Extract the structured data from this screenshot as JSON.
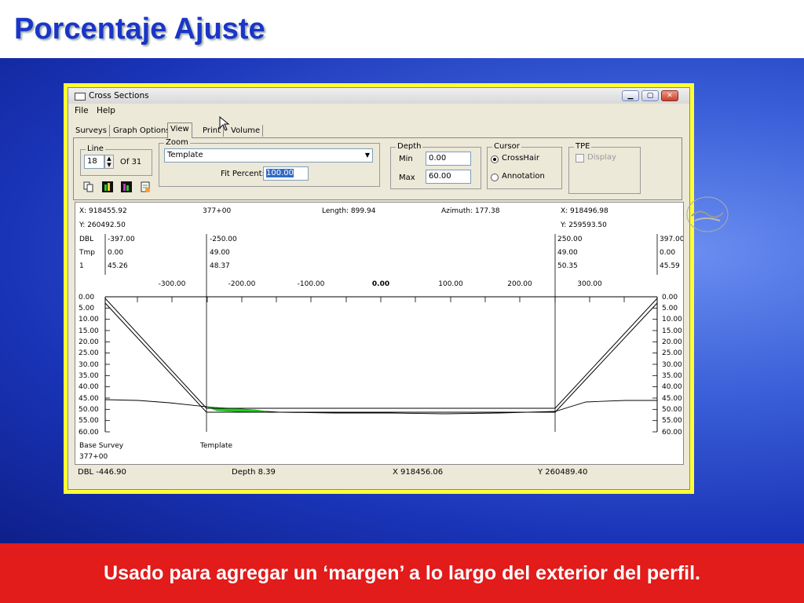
{
  "slide": {
    "title": "Porcentaje Ajuste",
    "footer": "Usado para agregar un ‘margen’ a lo largo del exterior del perfil."
  },
  "window": {
    "title": "Cross  Sections",
    "menu": [
      "File",
      "Help"
    ],
    "tabs": [
      "Surveys",
      "Graph Options",
      "View",
      "Print",
      "Volume"
    ],
    "active_tab": "View"
  },
  "line_group": {
    "label": "Line",
    "value": "18",
    "of_label": "Of  31"
  },
  "zoom_group": {
    "label": "Zoom",
    "selected": "Template",
    "fit_label": "Fit Percent:",
    "fit_value": "100.00"
  },
  "depth_group": {
    "label": "Depth",
    "min_label": "Min",
    "min_value": "0.00",
    "max_label": "Max",
    "max_value": "60.00"
  },
  "cursor_group": {
    "label": "Cursor",
    "option1": "CrossHair",
    "option2": "Annotation",
    "selected": "CrossHair"
  },
  "tpe_group": {
    "label": "TPE",
    "display_label": "Display"
  },
  "plot": {
    "x_left": "X: 918455.92",
    "station": "377+00",
    "length": "Length: 899.94",
    "azimuth": "Azimuth: 177.38",
    "x_right": "X: 918496.98",
    "y_left": "Y: 260492.50",
    "y_right": "Y: 259593.50",
    "row_labels": [
      "DBL",
      "Tmp",
      "1"
    ],
    "col1": [
      "-397.00",
      "0.00",
      "45.26"
    ],
    "col2": [
      "-250.00",
      "49.00",
      "48.37"
    ],
    "col3": [
      "250.00",
      "49.00",
      "50.35"
    ],
    "col4": [
      "397.00",
      "0.00",
      "45.59"
    ],
    "x_ticks": [
      "-300.00",
      "-200.00",
      "-100.00",
      "0.00",
      "100.00",
      "200.00",
      "300.00"
    ],
    "depth_ticks": [
      "0.00",
      "5.00",
      "10.00",
      "15.00",
      "20.00",
      "25.00",
      "30.00",
      "35.00",
      "40.00",
      "45.00",
      "50.00",
      "55.00",
      "60.00"
    ],
    "base_survey_label": "Base Survey",
    "template_label": "Template",
    "base_station": "377+00"
  },
  "status": {
    "dbl": "DBL -446.90",
    "depth": "Depth 8.39",
    "x": "X 918456.06",
    "y": "Y 260489.40"
  },
  "colors": {
    "title": "#1a35c8",
    "footer": "#e21b1b",
    "frame": "#ffff33",
    "fill": "#22cc22"
  }
}
